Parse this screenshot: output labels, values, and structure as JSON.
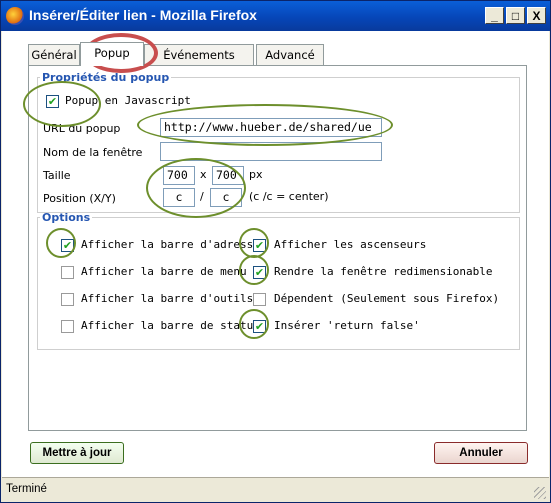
{
  "window": {
    "title": "Insérer/Éditer lien - Mozilla Firefox",
    "controls": {
      "minimize": "_",
      "maximize": "□",
      "close": "X"
    }
  },
  "tabs": [
    {
      "label": "Général",
      "active": false
    },
    {
      "label": "Popup",
      "active": true
    },
    {
      "label": "Événements",
      "active": false
    },
    {
      "label": "Advancé",
      "active": false
    }
  ],
  "popup_props": {
    "legend": "Propriétés du popup",
    "javascript_checkbox": {
      "label": "Popup en Javascript",
      "checked": true
    },
    "url": {
      "label": "URL du popup",
      "value": "http://www.hueber.de/shared/ue"
    },
    "window_name": {
      "label": "Nom de la fenêtre",
      "value": ""
    },
    "size": {
      "label": "Taille",
      "width": "700",
      "separator": "x",
      "height": "700",
      "unit": "px"
    },
    "position": {
      "label": "Position (X/Y)",
      "x": "c",
      "separator": "/",
      "y": "c",
      "hint": "(c /c = center)"
    }
  },
  "options": {
    "legend": "Options",
    "items": [
      {
        "label": "Afficher la barre d'adresse",
        "checked": true
      },
      {
        "label": "Afficher les ascenseurs",
        "checked": true
      },
      {
        "label": "Afficher la barre de menu",
        "checked": false
      },
      {
        "label": "Rendre la fenêtre redimensionable",
        "checked": true
      },
      {
        "label": "Afficher la barre d'outils",
        "checked": false
      },
      {
        "label": "Dépendent (Seulement sous Firefox)",
        "checked": false
      },
      {
        "label": "Afficher la barre de status",
        "checked": false
      },
      {
        "label": "Insérer 'return false'",
        "checked": true
      }
    ]
  },
  "buttons": {
    "update": "Mettre à jour",
    "cancel": "Annuler"
  },
  "statusbar": {
    "text": "Terminé"
  },
  "colors": {
    "titlebar": "#0a5fd8",
    "legend": "#2556b1",
    "annotation_green": "#6d8f2c",
    "annotation_red": "#c84e4e"
  }
}
